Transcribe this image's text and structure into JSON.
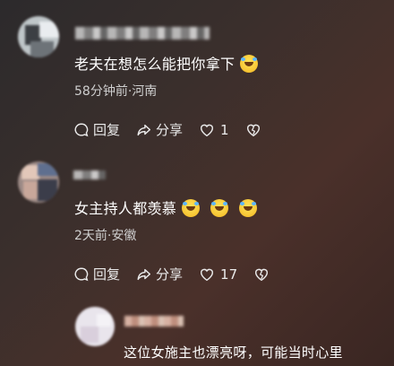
{
  "comments": [
    {
      "text": "老夫在想怎么能把你拿下",
      "emoji_count": 1,
      "meta": "58分钟前·河南",
      "reply_label": "回复",
      "share_label": "分享",
      "like_count": "1"
    },
    {
      "text": "女主持人都羡慕",
      "emoji_count": 3,
      "meta": "2天前·安徽",
      "reply_label": "回复",
      "share_label": "分享",
      "like_count": "17"
    },
    {
      "text": "这位女施主也漂亮呀，可能当时心里"
    }
  ],
  "icons": {
    "emoji": "laughing-tears-emoji",
    "reply": "speech-bubble-icon",
    "share": "share-arrow-icon",
    "like": "heart-icon",
    "dislike": "broken-heart-icon"
  }
}
